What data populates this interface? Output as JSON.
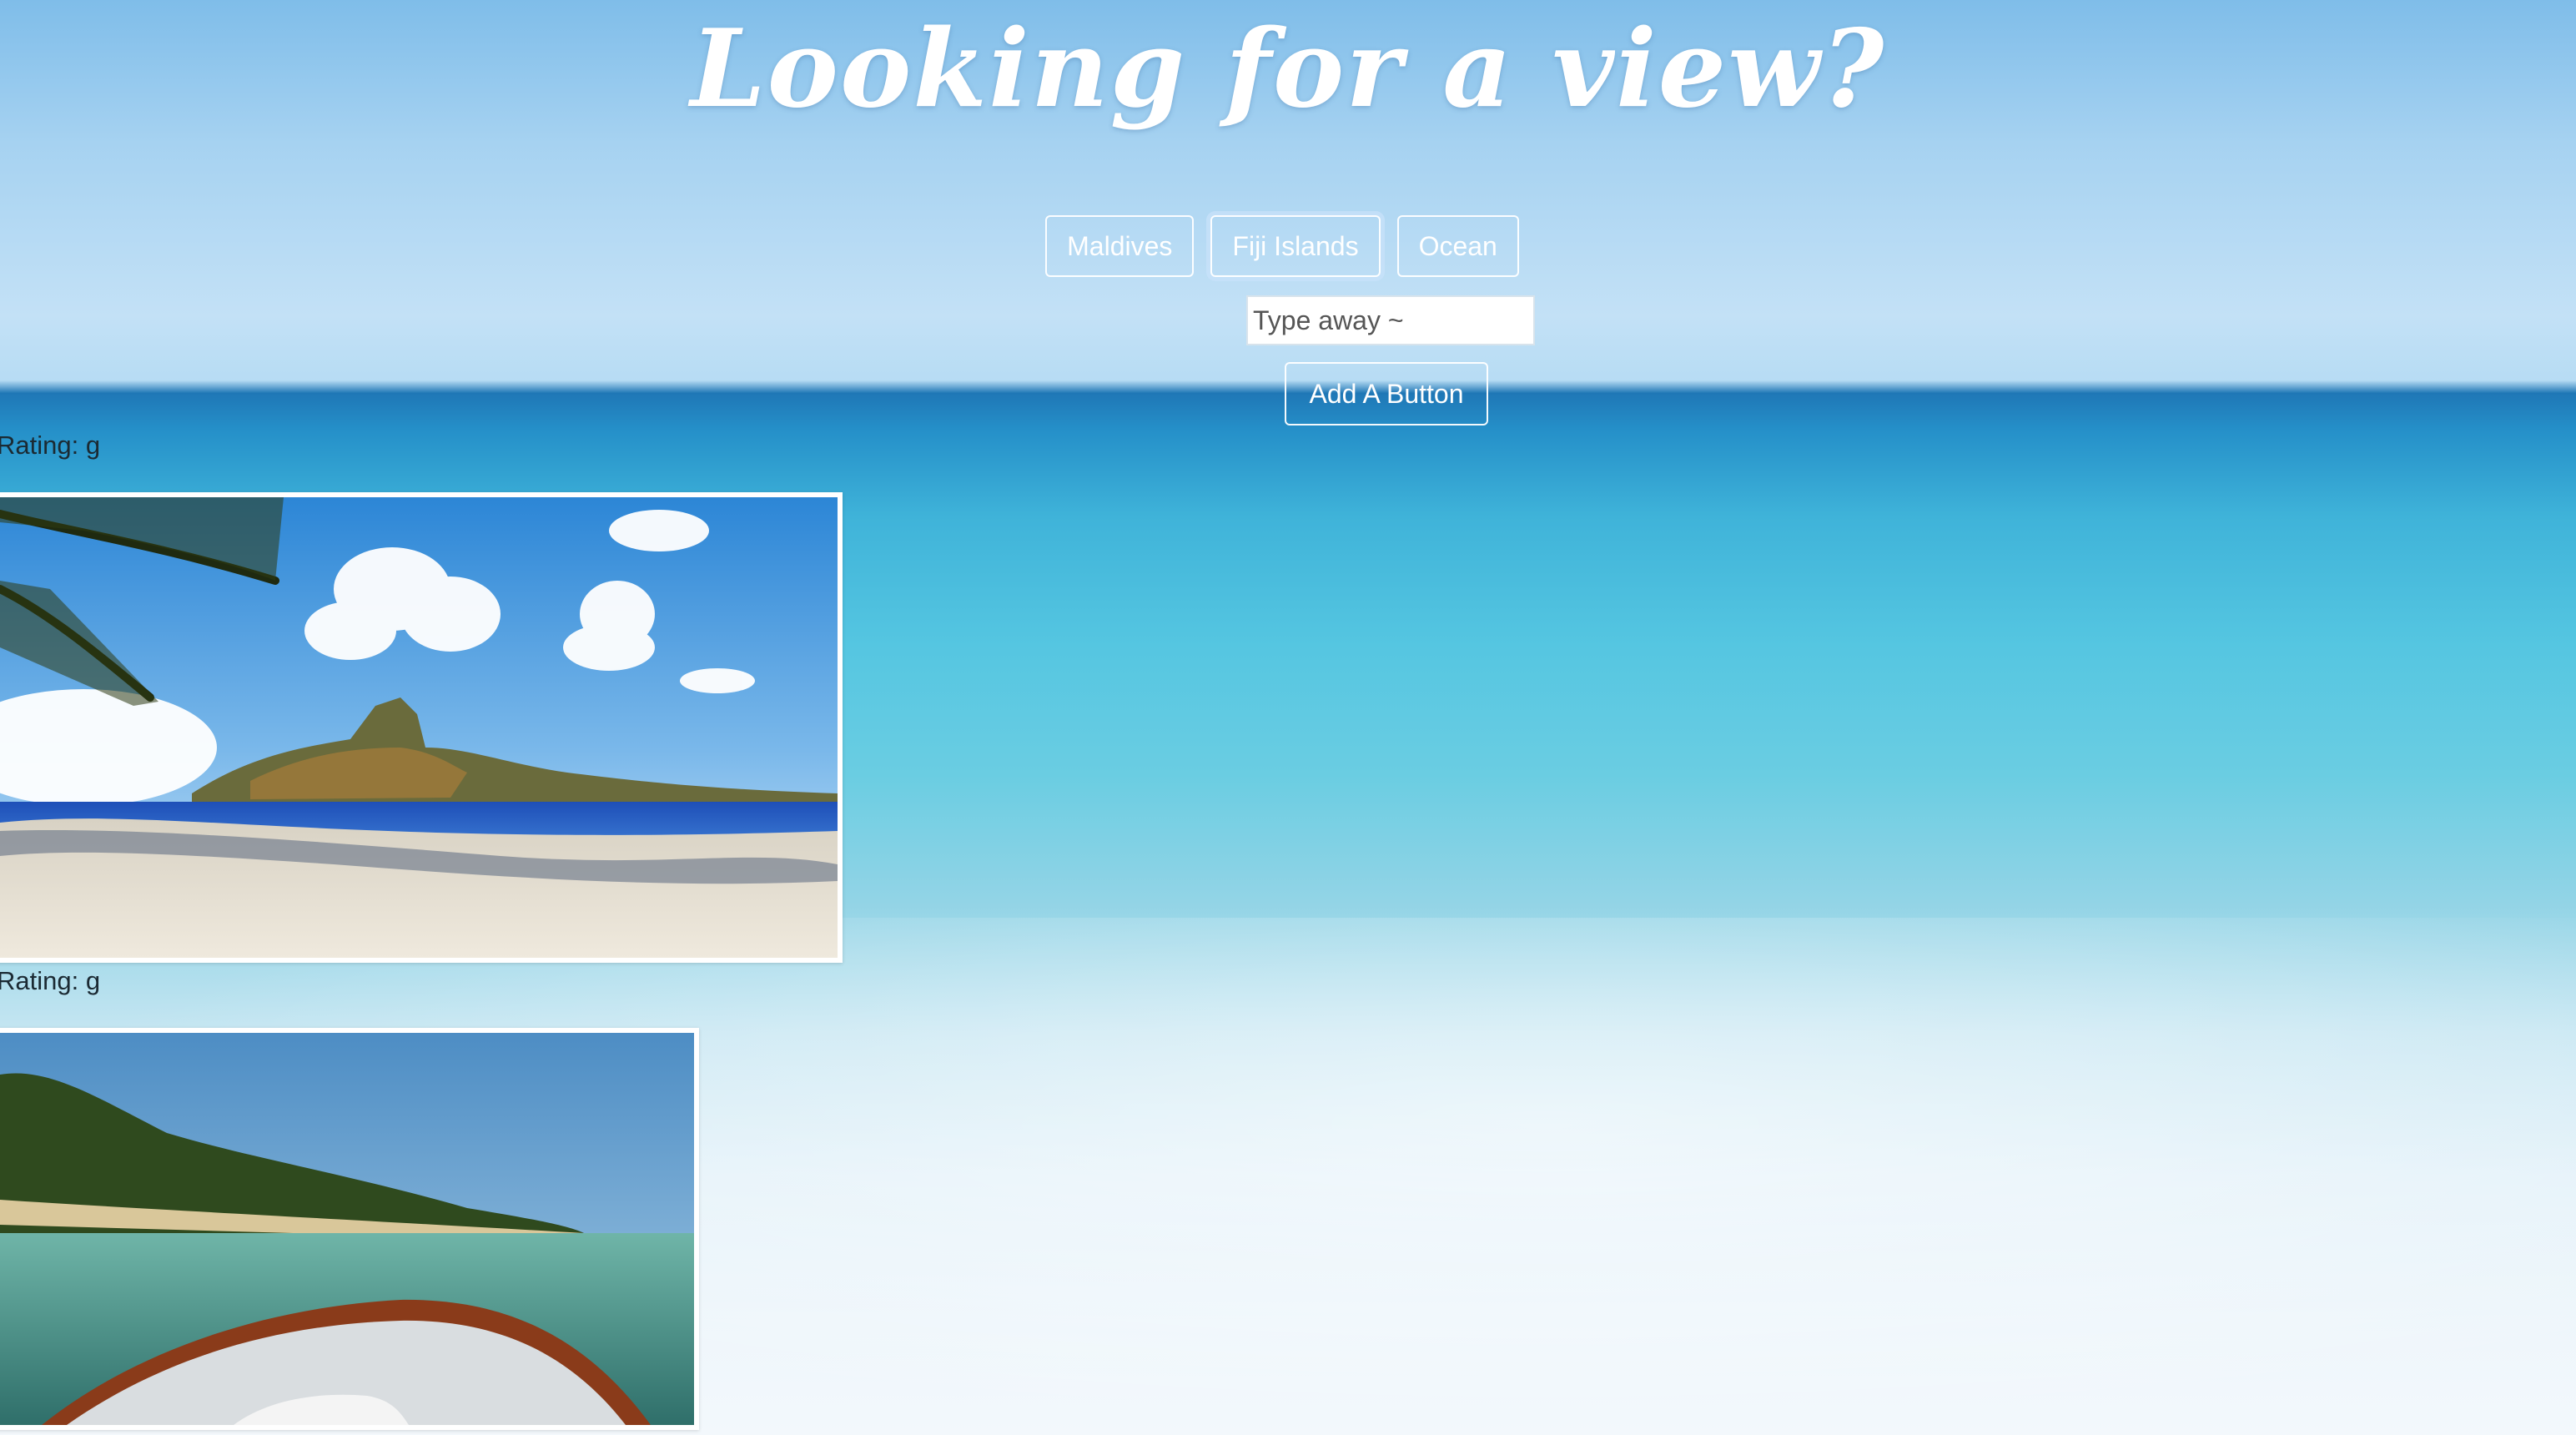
{
  "header": {
    "title": "Looking for a view?"
  },
  "topic_buttons": [
    {
      "label": "Maldives",
      "active": false
    },
    {
      "label": "Fiji Islands",
      "active": true
    },
    {
      "label": "Ocean",
      "active": false
    }
  ],
  "search": {
    "placeholder": "Type away ~",
    "value": ""
  },
  "add_button": {
    "label": "Add A Button"
  },
  "results": [
    {
      "rating": "Rating: g",
      "image_desc": "palm-beach-island"
    },
    {
      "rating": "Rating: g",
      "image_desc": "boat-bow-tropical-shore"
    }
  ],
  "colors": {
    "sky": "#a6d2f1",
    "ocean": "#3fb3d9",
    "button_border": "#ffffff",
    "text": "#1b2a33"
  }
}
